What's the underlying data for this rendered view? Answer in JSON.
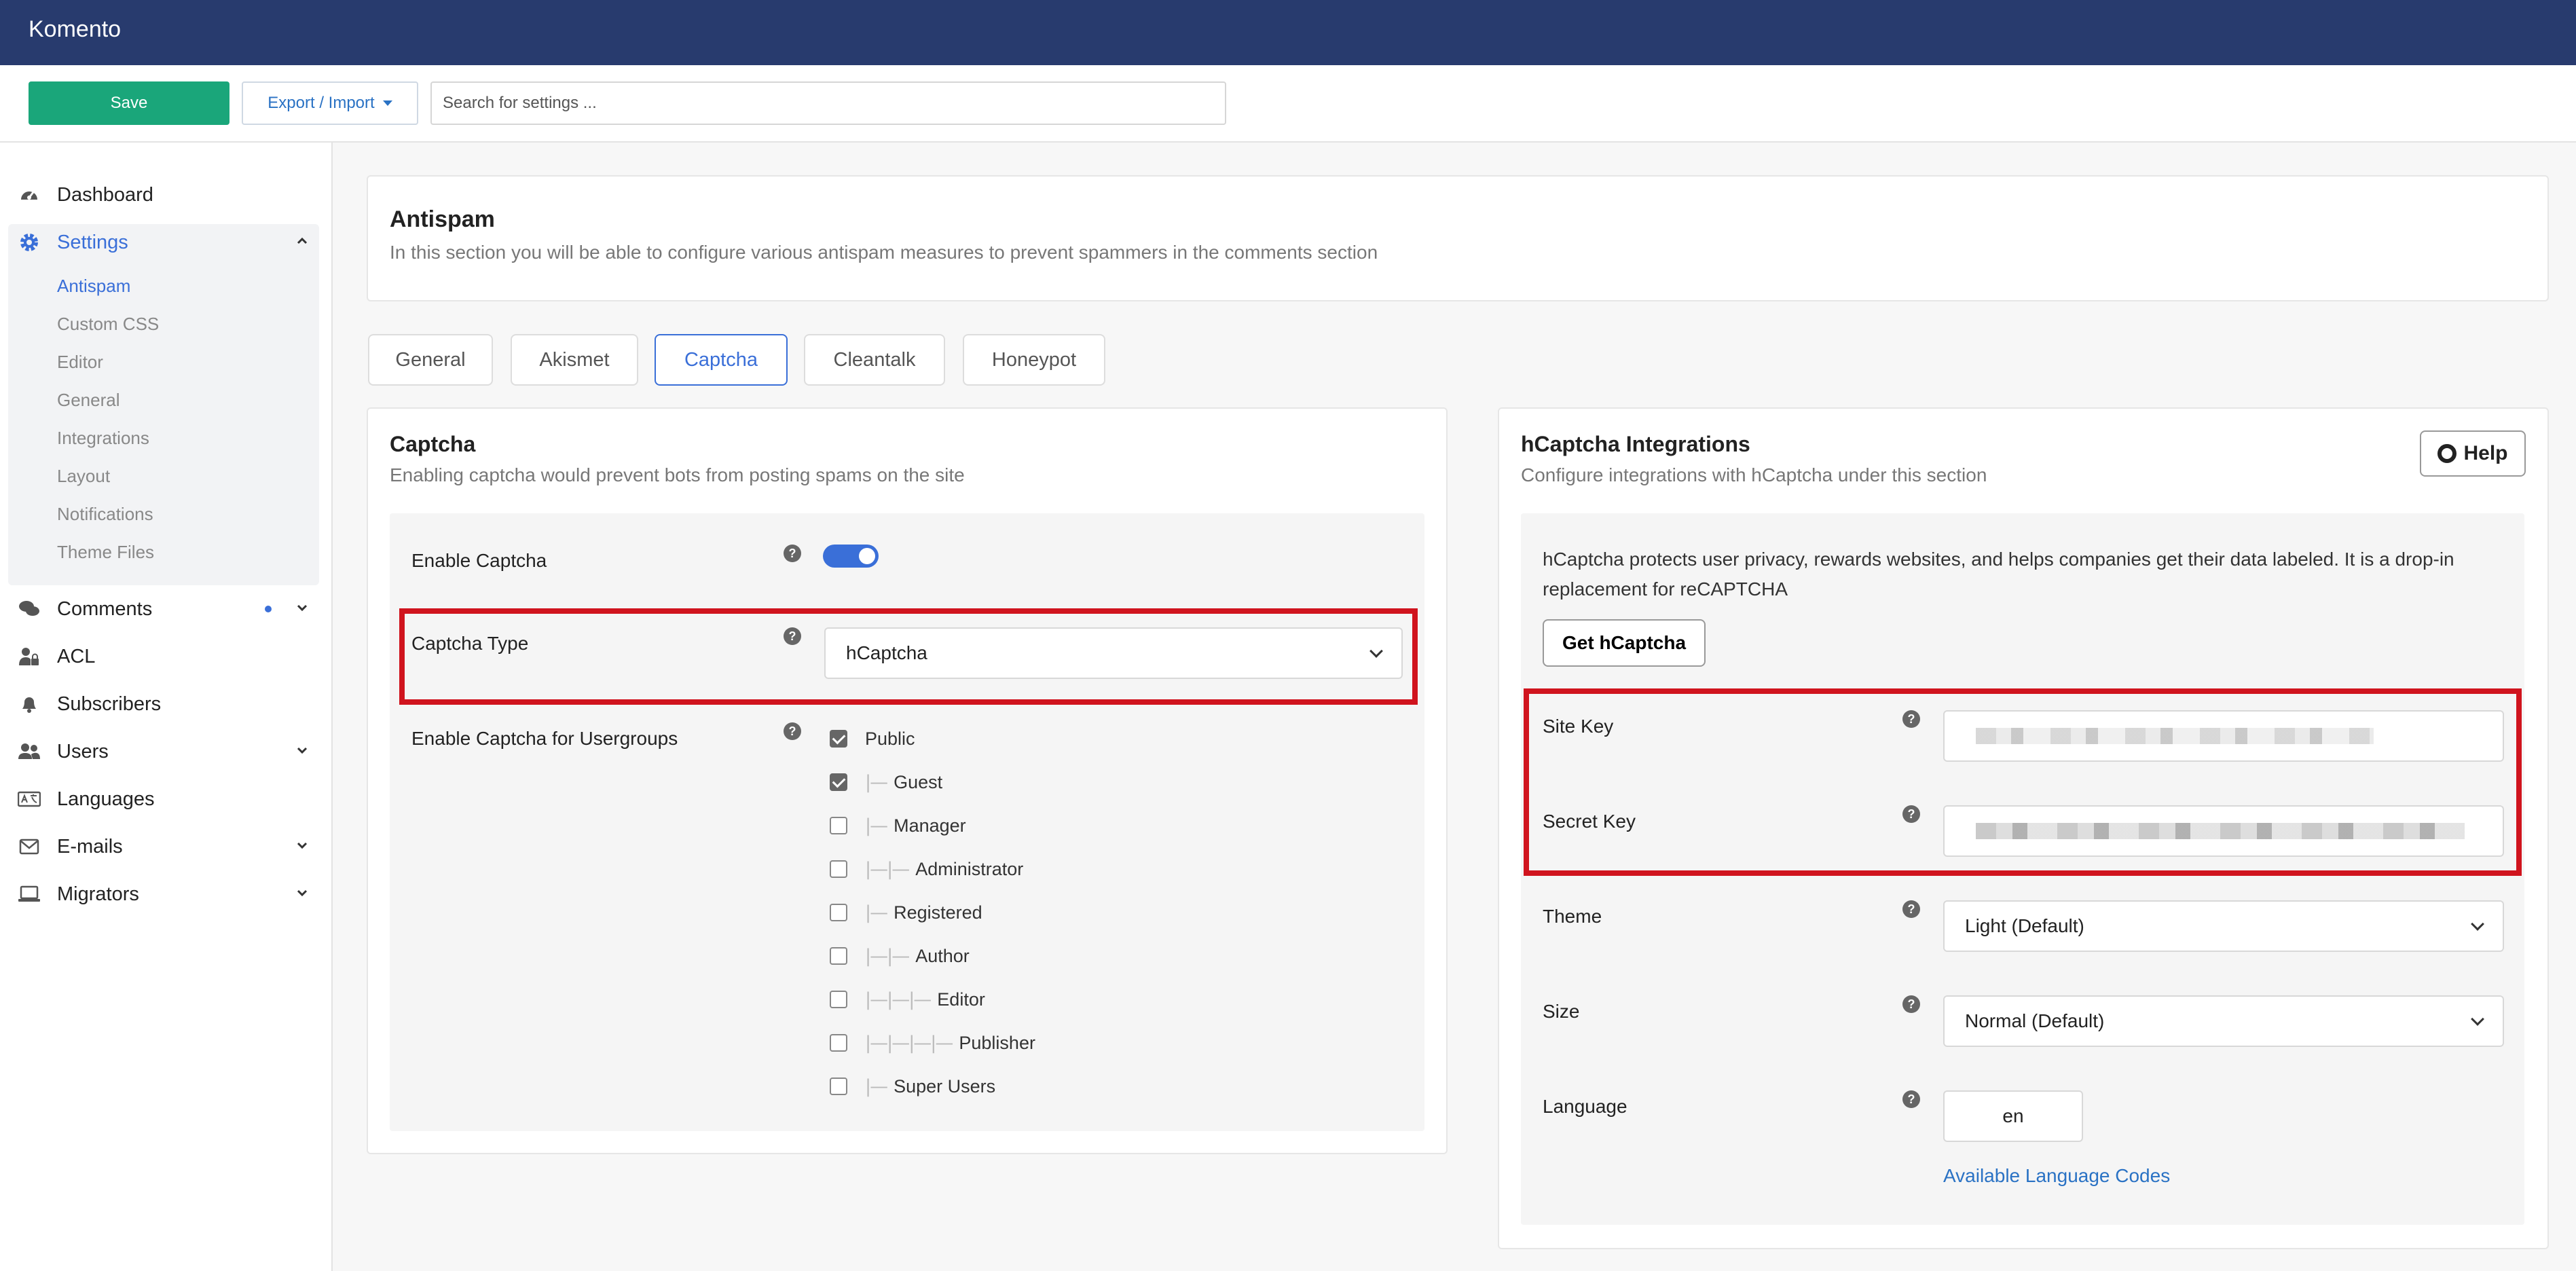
{
  "app": {
    "title": "Komento"
  },
  "toolbar": {
    "save_label": "Save",
    "export_label": "Export / Import",
    "search_placeholder": "Search for settings ..."
  },
  "sidebar": {
    "items": [
      {
        "label": "Dashboard",
        "icon": "dashboard-icon"
      },
      {
        "label": "Settings",
        "icon": "gear-icon",
        "active": true,
        "expanded": true
      },
      {
        "label": "Comments",
        "icon": "comments-icon",
        "has_dot": true
      },
      {
        "label": "ACL",
        "icon": "user-lock-icon"
      },
      {
        "label": "Subscribers",
        "icon": "bell-icon"
      },
      {
        "label": "Users",
        "icon": "users-icon"
      },
      {
        "label": "Languages",
        "icon": "language-icon"
      },
      {
        "label": "E-mails",
        "icon": "envelope-icon"
      },
      {
        "label": "Migrators",
        "icon": "laptop-icon"
      }
    ],
    "settings_sub": [
      "Antispam",
      "Custom CSS",
      "Editor",
      "General",
      "Integrations",
      "Layout",
      "Notifications",
      "Theme Files"
    ]
  },
  "header": {
    "title": "Antispam",
    "subtitle": "In this section you will be able to configure various antispam measures to prevent spammers in the comments section"
  },
  "tabs": [
    "General",
    "Akismet",
    "Captcha",
    "Cleantalk",
    "Honeypot"
  ],
  "captcha": {
    "title": "Captcha",
    "subtitle": "Enabling captcha would prevent bots from posting spams on the site",
    "enable_label": "Enable Captcha",
    "type_label": "Captcha Type",
    "type_value": "hCaptcha",
    "usergroups_label": "Enable Captcha for Usergroups",
    "usergroups": [
      {
        "name": "Public",
        "checked": true
      },
      {
        "name": "Guest",
        "checked": true
      },
      {
        "name": "Manager",
        "checked": false
      },
      {
        "name": "Administrator",
        "checked": false
      },
      {
        "name": "Registered",
        "checked": false
      },
      {
        "name": "Author",
        "checked": false
      },
      {
        "name": "Editor",
        "checked": false
      },
      {
        "name": "Publisher",
        "checked": false
      },
      {
        "name": "Super Users",
        "checked": false
      }
    ]
  },
  "hcaptcha": {
    "title": "hCaptcha Integrations",
    "subtitle": "Configure integrations with hCaptcha under this section",
    "help_label": "Help",
    "description": "hCaptcha protects user privacy, rewards websites, and helps companies get their data labeled. It is a drop-in replacement for reCAPTCHA",
    "get_button": "Get hCaptcha",
    "site_key_label": "Site Key",
    "secret_key_label": "Secret Key",
    "theme_label": "Theme",
    "theme_value": "Light (Default)",
    "size_label": "Size",
    "size_value": "Normal (Default)",
    "language_label": "Language",
    "language_value": "en",
    "language_link": "Available Language Codes"
  },
  "colors": {
    "topbar": "#283b6e",
    "accent": "#3a6fd8",
    "save": "#1aa67a",
    "highlight": "#d0141e"
  }
}
